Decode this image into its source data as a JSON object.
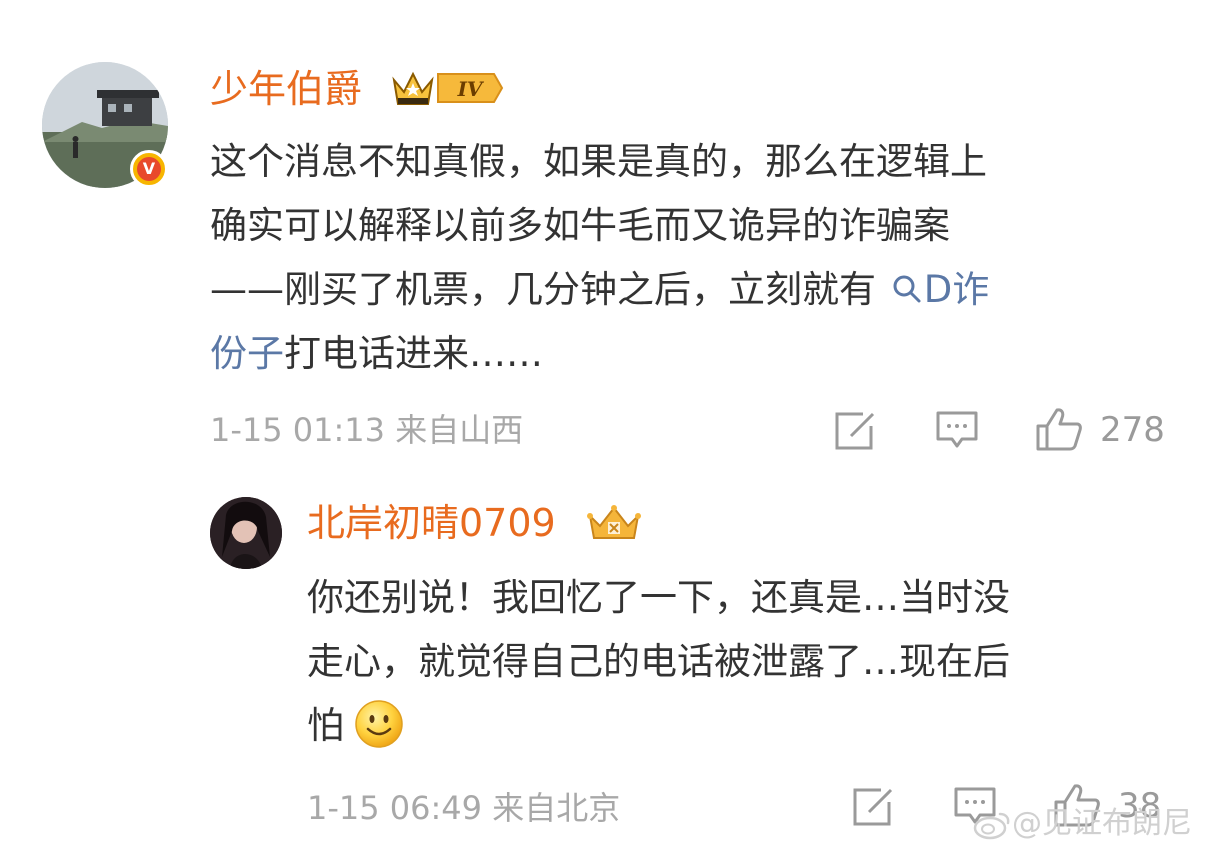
{
  "main_comment": {
    "username": "少年伯爵",
    "level_badge": "IV",
    "verified_badge": "V",
    "text_lines": [
      "这个消息不知真假，如果是真的，那么在逻辑上",
      "确实可以解释以前多如牛毛而又诡异的诈骗案",
      "——刚买了机票，几分钟之后，立刻就有",
      "打电话进来……"
    ],
    "mention_prefix_icon": "search-icon",
    "mention_part1": "D诈",
    "mention_part2": "份子",
    "meta": "1-15 01:13 来自山西",
    "like_count": "278"
  },
  "reply_comment": {
    "username": "北岸初晴0709",
    "text_lines": [
      "你还别说！我回忆了一下，还真是…当时没",
      "走心，就觉得自己的电话被泄露了…现在后",
      "怕"
    ],
    "emoji": "smiley-icon",
    "meta": "1-15 06:49 来自北京",
    "like_count": "38"
  },
  "watermark": "@见证布朗尼",
  "colors": {
    "username": "#e86b1f",
    "mention": "#5b78a6",
    "meta": "#a8a8a8",
    "text": "#333333"
  }
}
